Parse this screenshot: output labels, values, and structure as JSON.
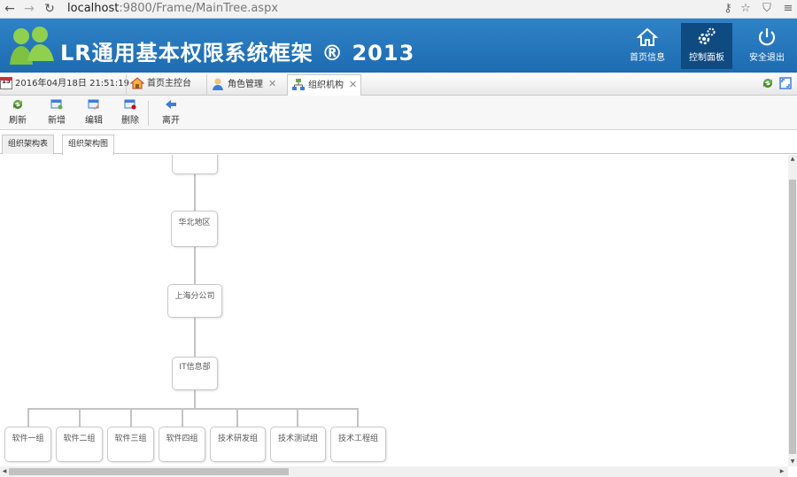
{
  "browser": {
    "url_host": "localhost",
    "url_path": ":9800/Frame/MainTree.aspx",
    "back_icon": "back-arrow-icon",
    "forward_icon": "forward-arrow-icon",
    "reload_icon": "reload-icon"
  },
  "header": {
    "title": "LR通用基本权限系统框架 ® 2013",
    "buttons": [
      {
        "label": "首页信息",
        "icon": "home-icon"
      },
      {
        "label": "控制面板",
        "icon": "gears-icon"
      },
      {
        "label": "安全退出",
        "icon": "power-icon"
      }
    ],
    "color_primary": "#1e6bb0",
    "color_active": "#0f4a80"
  },
  "tabbar": {
    "datetime": "2016年04月18日 21:51:19",
    "calendar_day": "15",
    "tabs": [
      {
        "label": "首页主控台",
        "closable": false
      },
      {
        "label": "角色管理",
        "closable": true
      },
      {
        "label": "组织机构",
        "closable": true
      }
    ],
    "close_glyph": "✕"
  },
  "toolbar": {
    "buttons": [
      {
        "label": "刷新",
        "icon": "refresh-icon"
      },
      {
        "label": "新增",
        "icon": "add-icon"
      },
      {
        "label": "编辑",
        "icon": "edit-icon"
      },
      {
        "label": "删除",
        "icon": "delete-icon"
      },
      {
        "label": "离开",
        "icon": "leave-icon"
      }
    ]
  },
  "subtabs": [
    {
      "label": "组织架构表"
    },
    {
      "label": "组织架构图"
    }
  ],
  "tree": {
    "top_node": "",
    "level1": "华北地区",
    "level2": "上海分公司",
    "level3": "IT信息部",
    "leaves": [
      "软件一组",
      "软件二组",
      "软件三组",
      "软件四组",
      "技术研发组",
      "技术测试组",
      "技术工程组"
    ]
  }
}
